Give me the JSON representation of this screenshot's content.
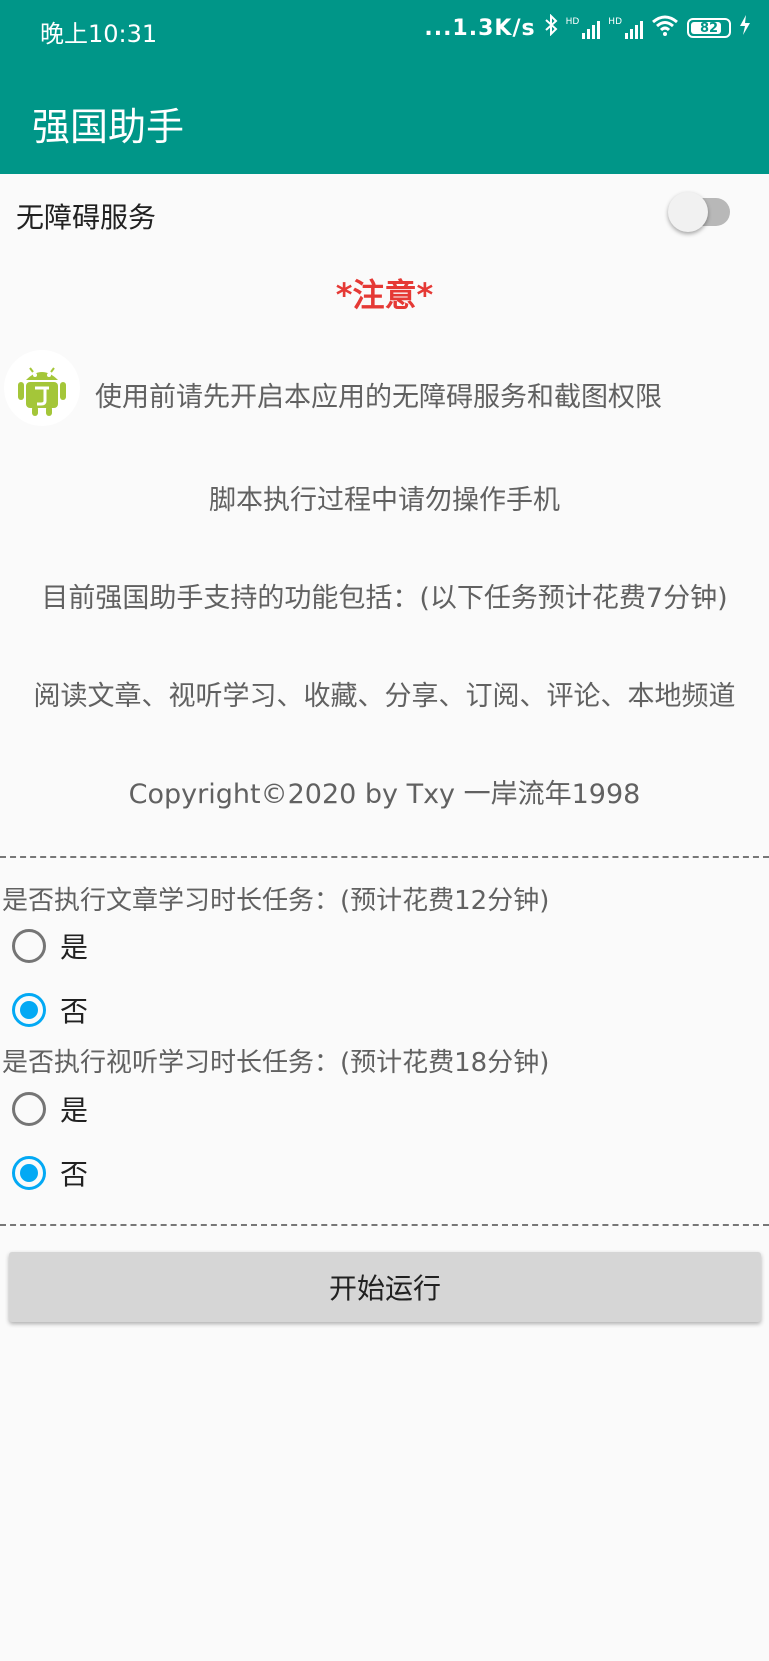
{
  "status_bar": {
    "time": "晚上10:31",
    "network_speed": "...1.3K/s",
    "battery_level": "82",
    "icons": [
      "bluetooth-icon",
      "signal-hd-icon",
      "signal-hd-icon",
      "wifi-icon",
      "battery-icon",
      "charging-icon"
    ]
  },
  "app_bar": {
    "title": "强国助手"
  },
  "accessibility": {
    "label": "无障碍服务",
    "enabled": false
  },
  "notice": {
    "title": "*注意*",
    "line1": "使用前请先开启本应用的无障碍服务和截图权限",
    "line2": "脚本执行过程中请勿操作手机",
    "line3": "目前强国助手支持的功能包括：(以下任务预计花费7分钟)",
    "line4": "阅读文章、视听学习、收藏、分享、订阅、评论、本地频道",
    "copyright": "Copyright©2020 by Txy 一岸流年1998"
  },
  "questions": [
    {
      "label": "是否执行文章学习时长任务：(预计花费12分钟)",
      "options": [
        "是",
        "否"
      ],
      "selected": "否"
    },
    {
      "label": "是否执行视听学习时长任务：(预计花费18分钟)",
      "options": [
        "是",
        "否"
      ],
      "selected": "否"
    }
  ],
  "start_button": {
    "label": "开始运行"
  },
  "colors": {
    "primary": "#009688",
    "accent": "#03a9f4",
    "notice": "#e53935"
  }
}
